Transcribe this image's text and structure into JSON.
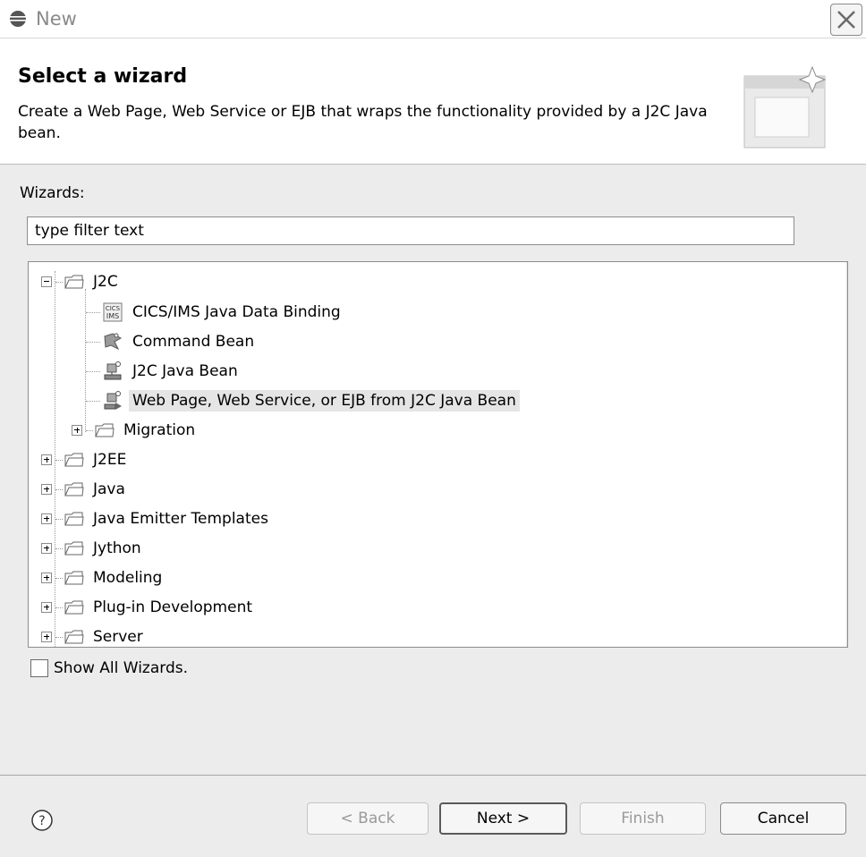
{
  "window": {
    "title": "New"
  },
  "header": {
    "title": "Select a wizard",
    "description": "Create a Web Page, Web Service or EJB that wraps the functionality provided by a J2C Java bean."
  },
  "wizards_label": "Wizards:",
  "filter": {
    "value": "type filter text"
  },
  "tree": {
    "j2c": "J2C",
    "cics": "CICS/IMS Java Data Binding",
    "command_bean": "Command Bean",
    "j2c_java_bean": "J2C Java Bean",
    "web_page": "Web Page, Web Service, or EJB from J2C Java Bean",
    "migration": "Migration",
    "j2ee": "J2EE",
    "java": "Java",
    "java_emitter": "Java Emitter Templates",
    "jython": "Jython",
    "modeling": "Modeling",
    "plugin": "Plug-in Development",
    "server": "Server"
  },
  "show_all": {
    "label": "Show All Wizards.",
    "checked": false
  },
  "buttons": {
    "back": "< Back",
    "next": "Next >",
    "finish": "Finish",
    "cancel": "Cancel"
  },
  "help_symbol": "?"
}
